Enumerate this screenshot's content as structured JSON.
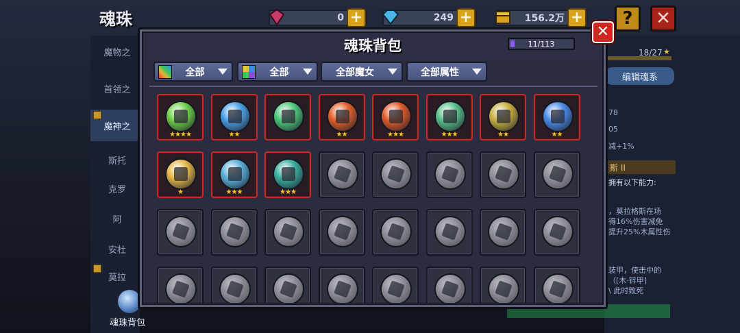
{
  "page": {
    "title": "魂珠"
  },
  "currencies": [
    {
      "name": "red-gem",
      "value": "0",
      "color": "#c93b6a"
    },
    {
      "name": "blue-diamond",
      "value": "249",
      "color": "#4ab6e6"
    },
    {
      "name": "gold-chest",
      "value": "156.2万",
      "color": "#d8a21c"
    }
  ],
  "sidebar": {
    "items": [
      {
        "label": "魔物之"
      },
      {
        "label": "首领之"
      },
      {
        "label": "魔神之"
      },
      {
        "label": "斯托"
      },
      {
        "label": "克罗"
      },
      {
        "label": "阿"
      },
      {
        "label": "安杜"
      },
      {
        "label": "莫拉"
      }
    ],
    "bottom_label": "魂珠背包"
  },
  "right_panel": {
    "progress": "18/27",
    "edit_button": "编辑魂系",
    "lines": [
      "78",
      "05",
      "减+1%"
    ],
    "section_head": "斯 II",
    "desc1": "拥有以下能力:",
    "desc2": "，莫拉格斯在场",
    "desc3": "得16%伤害减免",
    "desc4": "提升25%木属性伤",
    "desc5": "装甲，使击中的",
    "desc6": "（[木·锌甲]",
    "desc7": "\\  此时致死"
  },
  "modal": {
    "title": "魂珠背包",
    "capacity": "11/113",
    "capacity_fraction": 0.097,
    "close_symbol": "✕",
    "filters": [
      {
        "label": "全部",
        "icon": "rainbow-icon"
      },
      {
        "label": "全部",
        "icon": "quad-color-icon"
      },
      {
        "label": "全部魔女",
        "icon": ""
      },
      {
        "label": "全部属性",
        "icon": ""
      }
    ],
    "orbs": [
      {
        "owned": true,
        "stars": 4,
        "color": "#6fd04a",
        "icon": "rune-icon"
      },
      {
        "owned": true,
        "stars": 2,
        "color": "#4aa0e6",
        "icon": "dragon-icon"
      },
      {
        "owned": true,
        "stars": 0,
        "color": "#4ec87a",
        "icon": "fan-icon"
      },
      {
        "owned": true,
        "stars": 2,
        "color": "#e0602a",
        "icon": "rose-icon"
      },
      {
        "owned": true,
        "stars": 3,
        "color": "#e05a2a",
        "icon": "guitar-icon"
      },
      {
        "owned": true,
        "stars": 3,
        "color": "#5ac08a",
        "icon": "mage-icon"
      },
      {
        "owned": true,
        "stars": 2,
        "color": "#c8b040",
        "icon": "crystal-icon"
      },
      {
        "owned": true,
        "stars": 2,
        "color": "#4a8ae6",
        "icon": "sword-icon"
      },
      {
        "owned": true,
        "stars": 1,
        "color": "#e6b84a",
        "icon": "phoenix-icon"
      },
      {
        "owned": true,
        "stars": 3,
        "color": "#5ab0d8",
        "icon": "tree-icon"
      },
      {
        "owned": true,
        "stars": 3,
        "color": "#3ab0a0",
        "icon": "witch-icon"
      },
      {
        "owned": false,
        "stars": 0,
        "icon": "pot-icon"
      },
      {
        "owned": false,
        "stars": 0,
        "icon": "heart-icon"
      },
      {
        "owned": false,
        "stars": 0,
        "icon": "dagger-icon"
      },
      {
        "owned": false,
        "stars": 0,
        "icon": "book-icon"
      },
      {
        "owned": false,
        "stars": 0,
        "icon": "spear-icon"
      },
      {
        "owned": false,
        "stars": 0,
        "icon": "rock-icon"
      },
      {
        "owned": false,
        "stars": 0,
        "icon": "key-icon"
      },
      {
        "owned": false,
        "stars": 0,
        "icon": "cloak-icon"
      },
      {
        "owned": false,
        "stars": 0,
        "icon": "beast-icon"
      },
      {
        "owned": false,
        "stars": 0,
        "icon": "horn-icon"
      },
      {
        "owned": false,
        "stars": 0,
        "icon": "chain-icon"
      },
      {
        "owned": false,
        "stars": 0,
        "icon": "drill-icon"
      },
      {
        "owned": false,
        "stars": 0,
        "icon": "mask-icon"
      },
      {
        "owned": false,
        "stars": 0,
        "icon": "gear-icon"
      },
      {
        "owned": false,
        "stars": 0,
        "icon": "fist-icon"
      },
      {
        "owned": false,
        "stars": 0,
        "icon": "claw-icon"
      },
      {
        "owned": false,
        "stars": 0,
        "icon": "octopus-icon"
      },
      {
        "owned": false,
        "stars": 0,
        "icon": "staff-icon"
      },
      {
        "owned": false,
        "stars": 0,
        "icon": "skull-icon"
      },
      {
        "owned": false,
        "stars": 0,
        "icon": "shield-icon"
      },
      {
        "owned": false,
        "stars": 0,
        "icon": "serpent-icon"
      }
    ]
  }
}
